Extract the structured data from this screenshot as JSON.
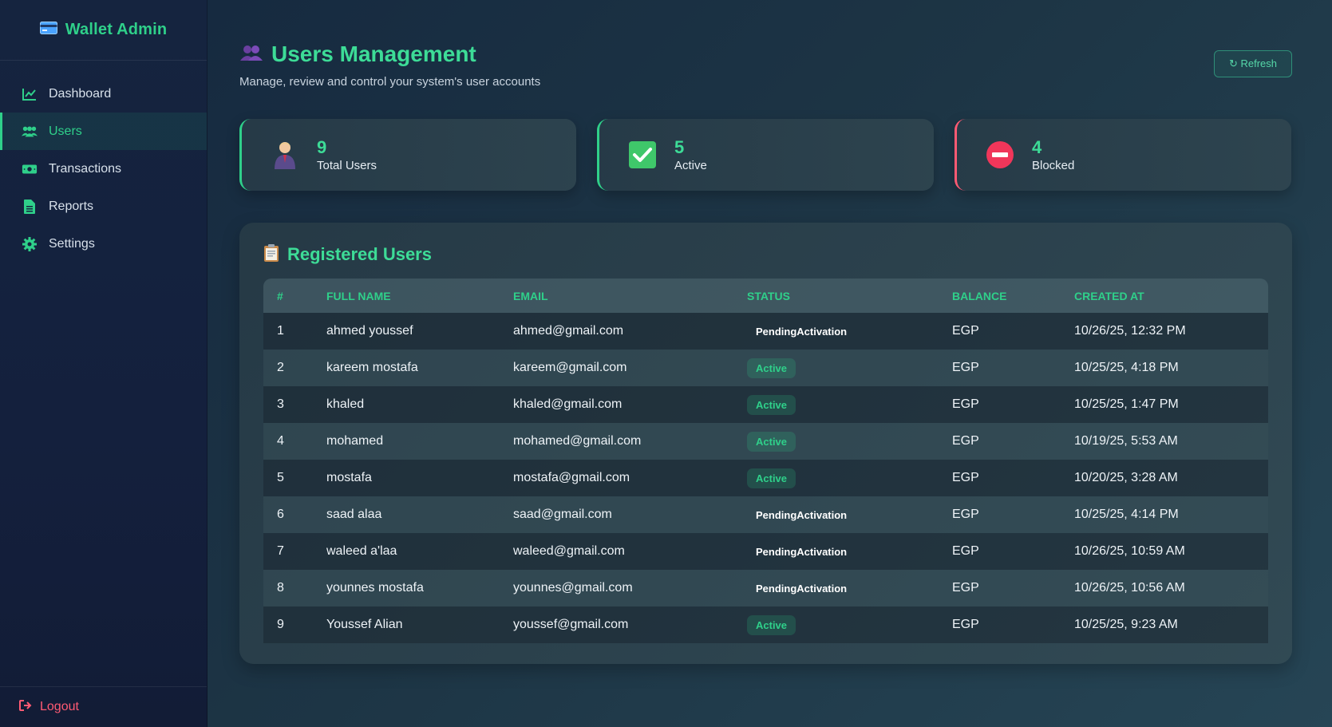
{
  "sidebar": {
    "brand_title": "Wallet Admin",
    "brand_icon": "credit-card-icon",
    "items": [
      {
        "label": "Dashboard",
        "icon": "chart-line-icon"
      },
      {
        "label": "Users",
        "icon": "users-icon"
      },
      {
        "label": "Transactions",
        "icon": "money-bill-icon"
      },
      {
        "label": "Reports",
        "icon": "file-icon"
      },
      {
        "label": "Settings",
        "icon": "gear-icon"
      }
    ],
    "active_item": "Users",
    "logout_label": "Logout"
  },
  "header": {
    "title": "Users Management",
    "subtitle": "Manage, review and control your system's user accounts",
    "refresh_label": "↻ Refresh"
  },
  "stats": [
    {
      "value": "9",
      "label": "Total Users",
      "icon": "person-icon"
    },
    {
      "value": "5",
      "label": "Active",
      "icon": "check-icon"
    },
    {
      "value": "4",
      "label": "Blocked",
      "icon": "no-entry-icon"
    }
  ],
  "panel": {
    "title": "Registered Users",
    "icon": "clipboard-icon"
  },
  "table": {
    "columns": [
      "#",
      "Full Name",
      "Email",
      "Status",
      "Balance",
      "Created At"
    ],
    "rows": [
      {
        "num": "1",
        "name": "ahmed youssef",
        "email": "ahmed@gmail.com",
        "status": "PendingActivation",
        "balance": "EGP",
        "created": "10/26/25, 12:32 PM"
      },
      {
        "num": "2",
        "name": "kareem mostafa",
        "email": "kareem@gmail.com",
        "status": "Active",
        "balance": "EGP",
        "created": "10/25/25, 4:18 PM"
      },
      {
        "num": "3",
        "name": "khaled",
        "email": "khaled@gmail.com",
        "status": "Active",
        "balance": "EGP",
        "created": "10/25/25, 1:47 PM"
      },
      {
        "num": "4",
        "name": "mohamed",
        "email": "mohamed@gmail.com",
        "status": "Active",
        "balance": "EGP",
        "created": "10/19/25, 5:53 AM"
      },
      {
        "num": "5",
        "name": "mostafa",
        "email": "mostafa@gmail.com",
        "status": "Active",
        "balance": "EGP",
        "created": "10/20/25, 3:28 AM"
      },
      {
        "num": "6",
        "name": "saad alaa",
        "email": "saad@gmail.com",
        "status": "PendingActivation",
        "balance": "EGP",
        "created": "10/25/25, 4:14 PM"
      },
      {
        "num": "7",
        "name": "waleed a'laa",
        "email": "waleed@gmail.com",
        "status": "PendingActivation",
        "balance": "EGP",
        "created": "10/26/25, 10:59 AM"
      },
      {
        "num": "8",
        "name": "younnes mostafa",
        "email": "younnes@gmail.com",
        "status": "PendingActivation",
        "balance": "EGP",
        "created": "10/26/25, 10:56 AM"
      },
      {
        "num": "9",
        "name": "Youssef Alian",
        "email": "youssef@gmail.com",
        "status": "Active",
        "balance": "EGP",
        "created": "10/25/25, 9:23 AM"
      }
    ]
  },
  "colors": {
    "accent": "#2fd08a",
    "danger": "#ff5a73",
    "sidebar_bg": "#15243f"
  }
}
